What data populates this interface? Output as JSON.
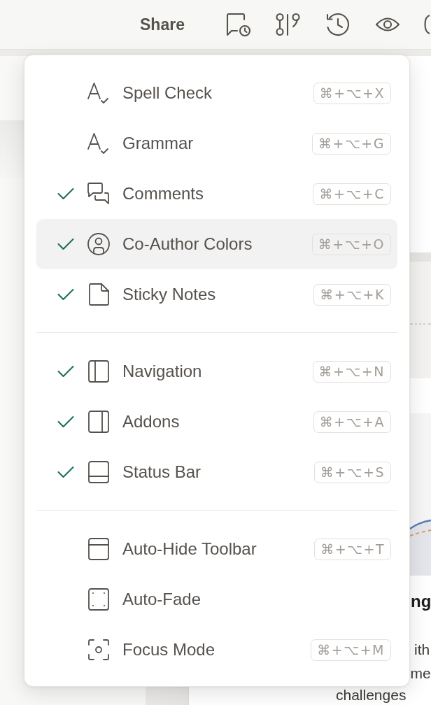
{
  "toolbar": {
    "share": "Share"
  },
  "menu": {
    "groups": [
      {
        "items": [
          {
            "label": "Spell Check",
            "shortcut": "⌘+⌥+X",
            "checked": false,
            "highlighted": false
          },
          {
            "label": "Grammar",
            "shortcut": "⌘+⌥+G",
            "checked": false,
            "highlighted": false
          },
          {
            "label": "Comments",
            "shortcut": "⌘+⌥+C",
            "checked": true,
            "highlighted": false
          },
          {
            "label": "Co-Author Colors",
            "shortcut": "⌘+⌥+O",
            "checked": true,
            "highlighted": true
          },
          {
            "label": "Sticky Notes",
            "shortcut": "⌘+⌥+K",
            "checked": true,
            "highlighted": false
          }
        ]
      },
      {
        "items": [
          {
            "label": "Navigation",
            "shortcut": "⌘+⌥+N",
            "checked": true,
            "highlighted": false
          },
          {
            "label": "Addons",
            "shortcut": "⌘+⌥+A",
            "checked": true,
            "highlighted": false
          },
          {
            "label": "Status Bar",
            "shortcut": "⌘+⌥+S",
            "checked": true,
            "highlighted": false
          }
        ]
      },
      {
        "items": [
          {
            "label": "Auto-Hide Toolbar",
            "shortcut": "⌘+⌥+T",
            "checked": false,
            "highlighted": false
          },
          {
            "label": "Auto-Fade",
            "checked": false,
            "highlighted": false
          },
          {
            "label": "Focus Mode",
            "shortcut": "⌘+⌥+M",
            "checked": false,
            "highlighted": false
          }
        ]
      }
    ]
  },
  "document": {
    "heading": "ng",
    "paragraph_lines": [
      "ith",
      "me",
      "challenges"
    ]
  }
}
